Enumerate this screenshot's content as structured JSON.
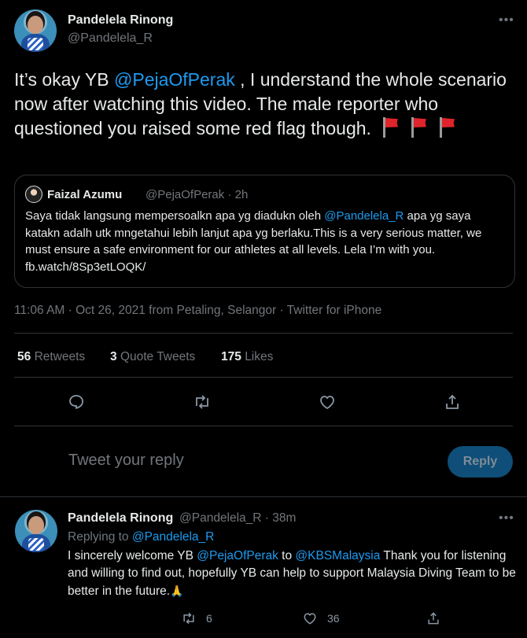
{
  "main_tweet": {
    "author_name": "Pandelela Rinong",
    "author_handle": "@Pandelela_R",
    "text_part1": "It’s okay YB ",
    "text_mention": "@PejaOfPerak",
    "text_part2": " , I understand the whole scenario now after watching this video. The male reporter who questioned you raised some red flag though.",
    "text_emoji": "red-flag-emoji x3",
    "quoted_tweet": {
      "author_name": "Faizal Azumu",
      "author_handle_time": "@PejaOfPerak · 2h",
      "text_part1": "Saya tidak langsung mempersoalkn apa yg diadukn oleh ",
      "text_mention": "@Pandelela_R",
      "text_part2": " apa yg saya katakn adalh utk mngetahui lebih lanjut apa yg berlaku.This is a very serious matter, we must ensure a safe environment for our athletes at all levels. Lela I’m with you. fb.watch/8Sp3etLOQK/"
    },
    "meta": "11:06 AM · Oct 26, 2021 from Petaling, Selangor · Twitter for iPhone",
    "stats": {
      "retweets_count": "56",
      "retweets_label": "Retweets",
      "quote_count": "3",
      "quote_label": "Quote Tweets",
      "likes_count": "175",
      "likes_label": "Likes"
    },
    "actions": [
      "reply-icon",
      "retweet-icon",
      "like-icon",
      "share-icon"
    ]
  },
  "reply_box": {
    "placeholder": "Tweet your reply",
    "button_label": "Reply"
  },
  "reply_tweet": {
    "author_name": "Pandelela Rinong",
    "author_handle_time": "@Pandelela_R · 38m",
    "replying_to_label": "Replying to ",
    "replying_to_handle": "@Pandelela_R",
    "text_part1": "I sincerely welcome YB ",
    "text_mention1": "@PejaOfPerak",
    "text_part2": " to ",
    "text_mention2": "@KBSMalaysia",
    "text_part3": " Thank you for listening and willing to find out, hopefully YB can help to support Malaysia Diving Team to be better in the future.",
    "text_emoji": "🙏",
    "retweet_count": "6",
    "like_count": "36"
  },
  "colors": {
    "background": "#000000",
    "link": "#1d9bf0",
    "muted": "#71767b",
    "reply_button_bg": "#0f4e78"
  }
}
